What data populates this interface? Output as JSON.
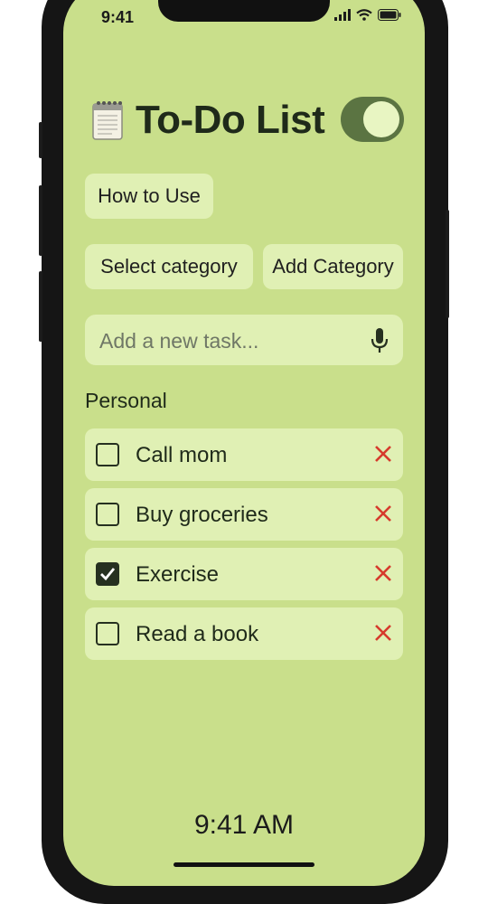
{
  "status_bar": {
    "time": "9:41"
  },
  "header": {
    "title": "To-Do List",
    "icon": "notepad-icon",
    "theme_toggle_on": true
  },
  "buttons": {
    "how_to_use": "How to Use",
    "select_category": "Select category",
    "add_category": "Add Category"
  },
  "task_input": {
    "placeholder": "Add a new task...",
    "value": "",
    "icon": "microphone-icon"
  },
  "category": {
    "name": "Personal"
  },
  "tasks": [
    {
      "label": "Call mom",
      "done": false
    },
    {
      "label": "Buy groceries",
      "done": false
    },
    {
      "label": "Exercise",
      "done": true
    },
    {
      "label": "Read a book",
      "done": false
    }
  ],
  "footer": {
    "clock": "9:41 AM"
  },
  "colors": {
    "background": "#c9df8b",
    "card": "#e0f0b4",
    "toggle": "#5b7442",
    "delete": "#d63a2c",
    "text": "#1f2a1a"
  }
}
